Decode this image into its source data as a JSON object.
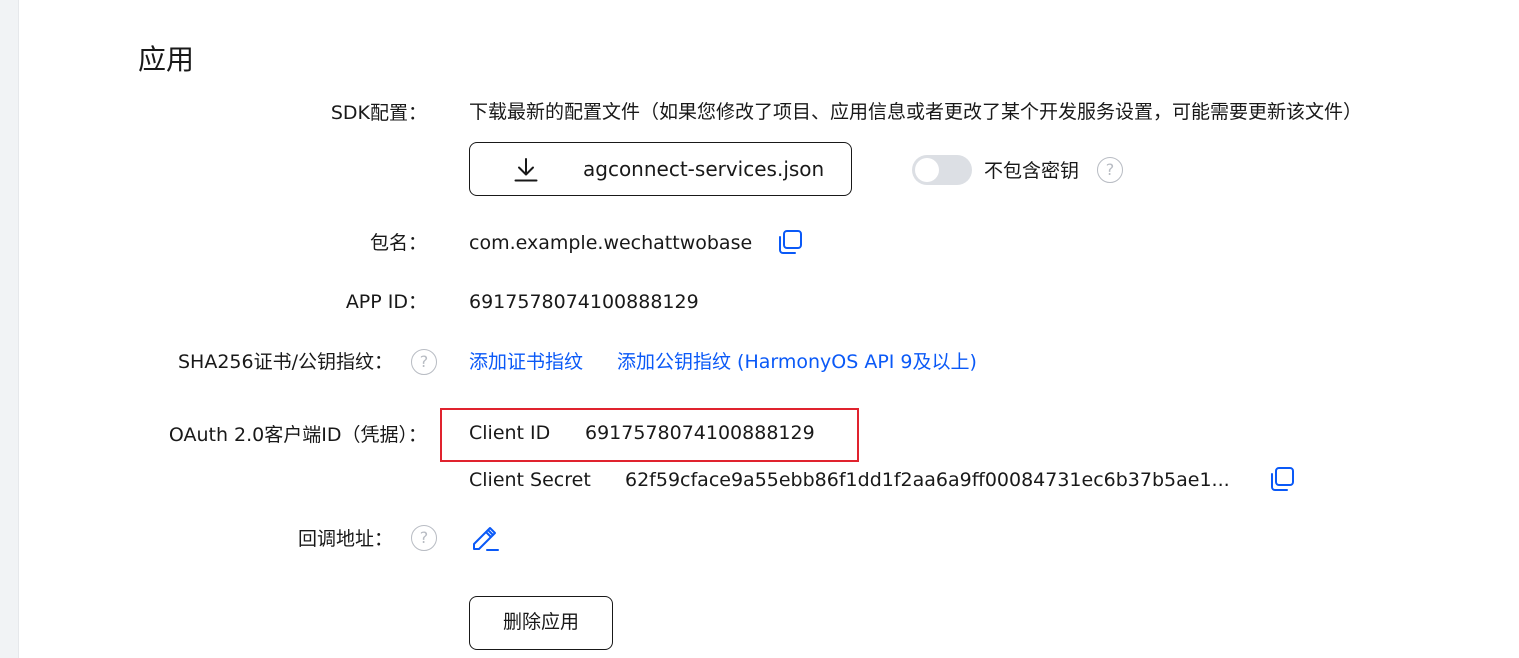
{
  "section": {
    "title": "应用"
  },
  "sdk": {
    "label": "SDK配置：",
    "description": "下载最新的配置文件（如果您修改了项目、应用信息或者更改了某个开发服务设置，可能需要更新该文件）",
    "download_label": "agconnect-services.json",
    "toggle_label": "不包含密钥",
    "toggle_on": false
  },
  "package": {
    "label": "包名：",
    "value": "com.example.wechattwobase"
  },
  "app_id": {
    "label": "APP ID：",
    "value": "6917578074100888129"
  },
  "sha256": {
    "label": "SHA256证书/公钥指纹：",
    "add_cert_link": "添加证书指纹",
    "add_pubkey_link": "添加公钥指纹 (HarmonyOS API 9及以上)"
  },
  "oauth": {
    "label": "OAuth 2.0客户端ID（凭据）：",
    "client_id_label": "Client ID",
    "client_id_value": "6917578074100888129",
    "client_secret_label": "Client Secret",
    "client_secret_value": "62f59cface9a55ebb86f1dd1f2aa6a9ff00084731ec6b37b5ae1..."
  },
  "callback": {
    "label": "回调地址："
  },
  "actions": {
    "delete_label": "删除应用"
  },
  "icons": {
    "help": "question-circle-icon",
    "copy": "copy-icon",
    "download": "download-icon",
    "edit": "edit-pen-icon"
  },
  "colors": {
    "link": "#0a59f7",
    "highlight_border": "#e0232e",
    "text": "#191919",
    "toggle_off": "#dcdfe4"
  }
}
